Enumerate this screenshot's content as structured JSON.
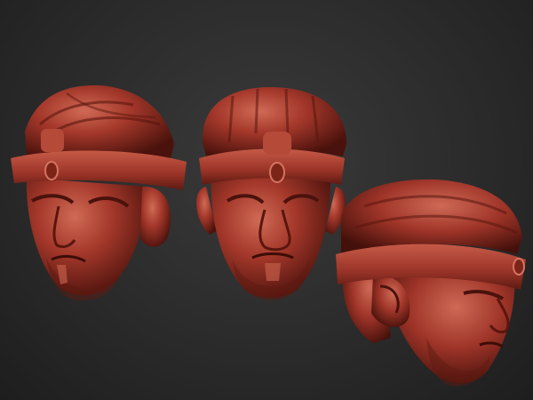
{
  "scene": {
    "background_color": "#2d2d2d",
    "clay_color": "#a3372a",
    "clay_highlight": "#d06a55",
    "clay_shadow": "#4a120c",
    "objects": [
      {
        "name": "head-three-quarter-left",
        "view": "three-quarter"
      },
      {
        "name": "head-front",
        "view": "front"
      },
      {
        "name": "head-three-quarter-right",
        "view": "three-quarter-side"
      }
    ]
  }
}
